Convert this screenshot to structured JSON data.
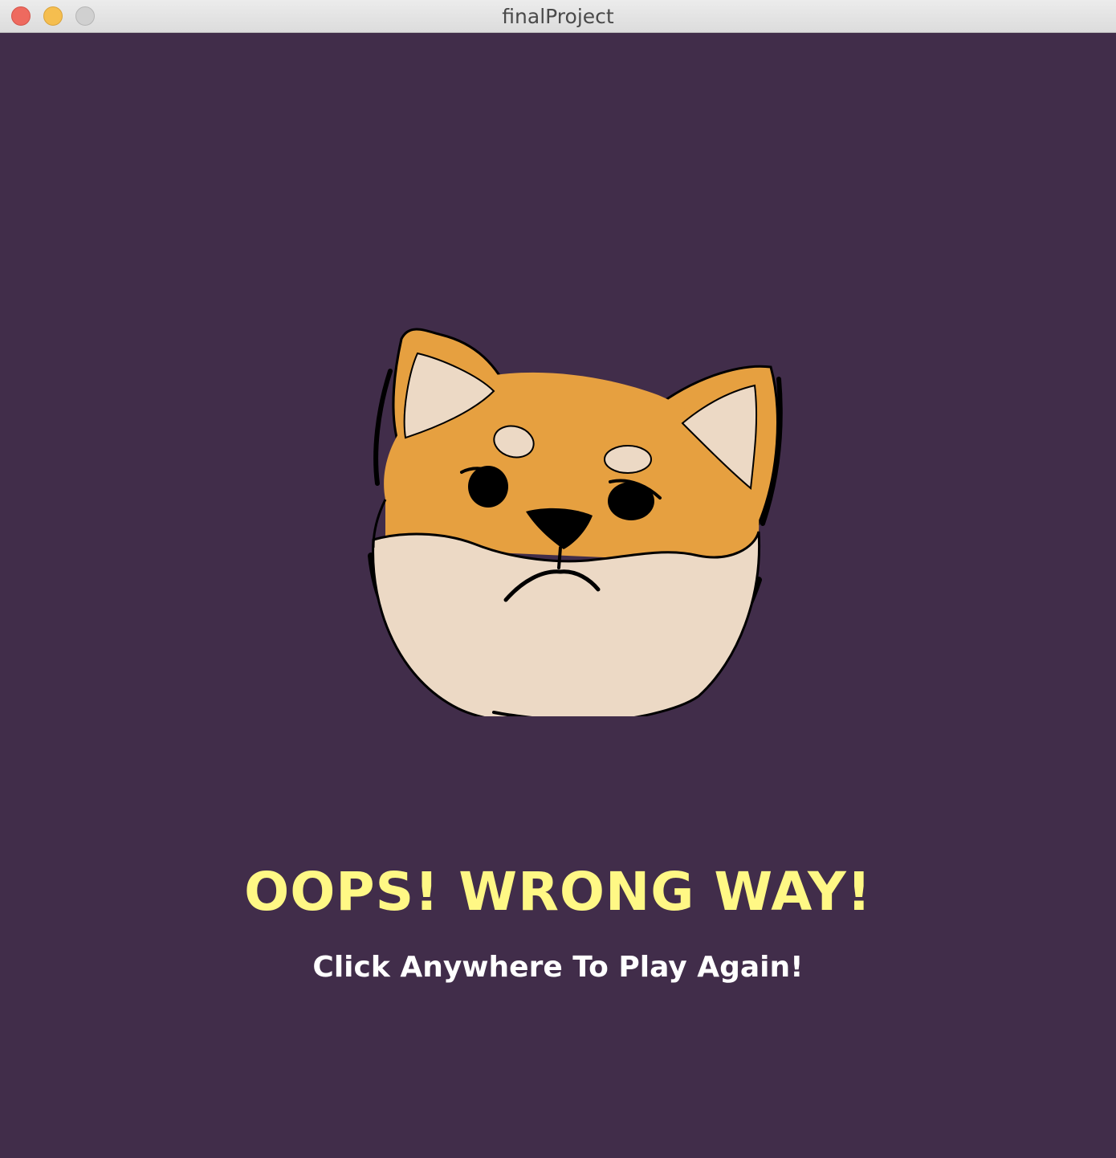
{
  "window": {
    "title": "finalProject"
  },
  "game": {
    "headline": "OOPS! WRONG WAY!",
    "prompt": "Click Anywhere To Play Again!",
    "character_icon": "sad-shiba-dog-icon"
  },
  "colors": {
    "background": "#412d4a",
    "headline": "#fff885",
    "prompt": "#ffffff",
    "fur_orange": "#e6a040",
    "fur_cream": "#ecd9c5"
  }
}
